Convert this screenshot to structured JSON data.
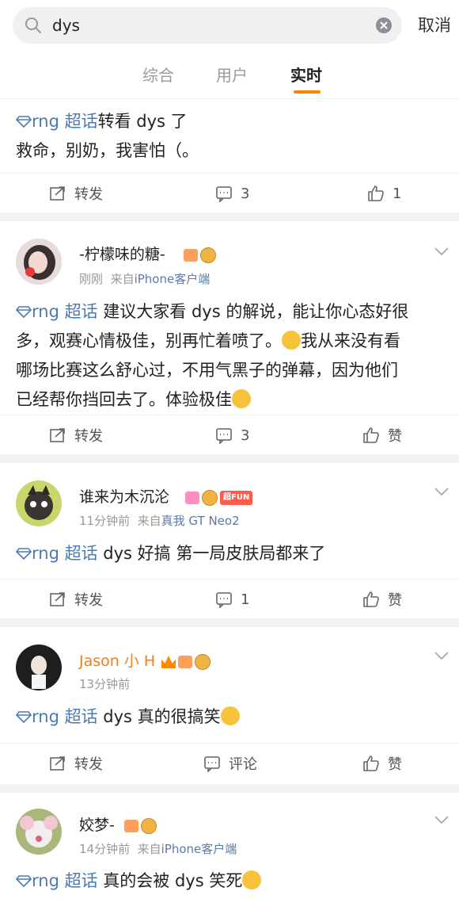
{
  "search": {
    "query": "dys",
    "cancel_label": "取消"
  },
  "tabs": [
    {
      "label": "综合",
      "active": false
    },
    {
      "label": "用户",
      "active": false
    },
    {
      "label": "实时",
      "active": true
    }
  ],
  "topic_label": "rng 超话",
  "colors": {
    "accent": "#ff8200",
    "link": "#4a7ab5",
    "username_vip": "#ef7f18"
  },
  "posts": [
    {
      "text": "转看 dys 了\n救命，别奶，我害怕（。",
      "text_line1": "转看 dys 了",
      "text_line2": "救命，别奶，我害怕（。",
      "actions": {
        "repost": "转发",
        "comments": "3",
        "likes": "1"
      }
    },
    {
      "username": "-柠檬味的糖-",
      "time": "刚刚",
      "source_prefix": "来自",
      "source": "iPhone客户端",
      "text_line1": " 建议大家看 dys 的解说，能让你心态好很",
      "text_line2": "多，观赛心情极佳，别再忙着喷了。",
      "text_line2b": "我从来没有看",
      "text_line3": "哪场比赛这么舒心过，不用气黑子的弹幕，因为他们",
      "text_line4": "已经帮你挡回去了。体验极佳",
      "actions": {
        "repost": "转发",
        "comments": "3",
        "likes": "赞"
      }
    },
    {
      "username": "谁来为木沉沦",
      "badge_text": "超FUN",
      "time": "11分钟前",
      "source_prefix": "来自",
      "source": "真我 GT Neo2",
      "text_line1": " dys 好搞 第一局皮肤局都来了",
      "actions": {
        "repost": "转发",
        "comments": "1",
        "likes": "赞"
      }
    },
    {
      "username": "Jason 小 H",
      "time": "13分钟前",
      "text_line1": " dys 真的很搞笑",
      "actions": {
        "repost": "转发",
        "comments": "评论",
        "likes": "赞"
      }
    },
    {
      "username": "姣梦-",
      "time": "14分钟前",
      "source_prefix": "来自",
      "source": "iPhone客户端",
      "text_line1": " 真的会被 dys 笑死"
    }
  ]
}
